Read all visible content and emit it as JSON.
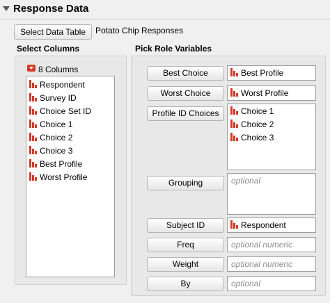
{
  "header": {
    "title": "Response Data"
  },
  "data_table": {
    "button_label": "Select Data Table",
    "name": "Potato Chip Responses"
  },
  "select_columns": {
    "label": "Select Columns",
    "count_label": "8 Columns",
    "columns": [
      "Respondent",
      "Survey ID",
      "Choice Set ID",
      "Choice 1",
      "Choice 2",
      "Choice 3",
      "Best Profile",
      "Worst Profile"
    ]
  },
  "pick_roles": {
    "label": "Pick Role Variables",
    "roles": [
      {
        "button": "Best Choice",
        "values": [
          "Best Profile"
        ],
        "placeholder": ""
      },
      {
        "button": "Worst Choice",
        "values": [
          "Worst Profile"
        ],
        "placeholder": ""
      },
      {
        "button": "Profile ID Choices",
        "values": [
          "Choice 1",
          "Choice 2",
          "Choice 3"
        ],
        "placeholder": ""
      },
      {
        "button": "Grouping",
        "values": [],
        "placeholder": "optional"
      },
      {
        "button": "Subject ID",
        "values": [
          "Respondent"
        ],
        "placeholder": ""
      },
      {
        "button": "Freq",
        "values": [],
        "placeholder": "optional numeric"
      },
      {
        "button": "Weight",
        "values": [],
        "placeholder": "optional numeric"
      },
      {
        "button": "By",
        "values": [],
        "placeholder": "optional"
      }
    ]
  },
  "icons": {
    "column_type": "continuous-bar-icon",
    "menu": "red-triangle-icon"
  },
  "colors": {
    "icon_red": "#d43a2a",
    "panel_bg": "#e8e8e8"
  }
}
